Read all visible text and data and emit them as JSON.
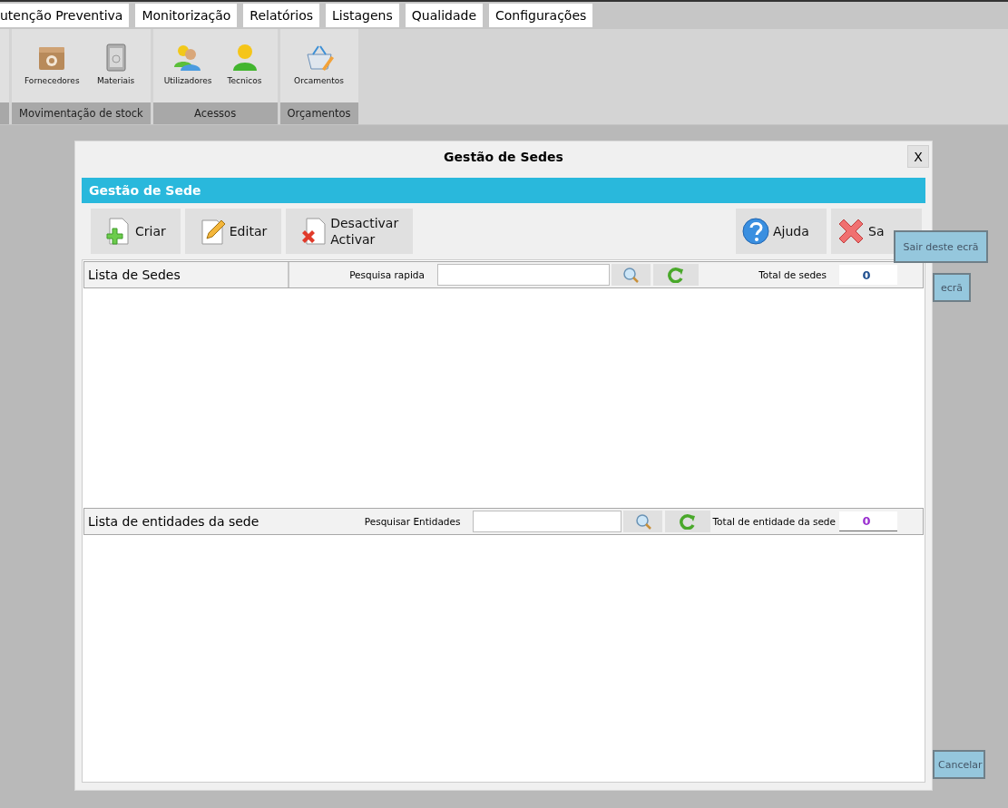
{
  "menu_tabs": [
    {
      "label": "utenção Preventiva"
    },
    {
      "label": "Monitorização"
    },
    {
      "label": "Relatórios"
    },
    {
      "label": "Listagens"
    },
    {
      "label": "Qualidade"
    },
    {
      "label": "Configurações"
    }
  ],
  "ribbon": {
    "groups": [
      {
        "label": "Movimentação de stock",
        "items": [
          {
            "label": "Fornecedores",
            "kind": "box"
          },
          {
            "label": "Materiais",
            "kind": "safe"
          }
        ]
      },
      {
        "label": "Acessos",
        "items": [
          {
            "label": "Utilizadores",
            "kind": "users"
          },
          {
            "label": "Tecnicos",
            "kind": "person"
          }
        ]
      },
      {
        "label": "Orçamentos",
        "items": [
          {
            "label": "Orcamentos",
            "kind": "basket"
          }
        ]
      }
    ]
  },
  "background_buttons": [
    {
      "label": "ecrã"
    },
    {
      "label": "Cancelar"
    }
  ],
  "dialog": {
    "title": "Gestão de Sedes",
    "close": "X",
    "header": "Gestão de Sede",
    "toolbar_left": [
      {
        "lines": [
          "Criar"
        ],
        "kind": "new"
      },
      {
        "lines": [
          "Editar"
        ],
        "kind": "edit"
      },
      {
        "lines": [
          "Desactivar",
          "Activar"
        ],
        "kind": "delete"
      }
    ],
    "toolbar_right": [
      {
        "lines": [
          "Ajuda"
        ],
        "kind": "help"
      },
      {
        "lines": [
          "Sa"
        ],
        "kind": "exit"
      }
    ],
    "tooltip": "Sair deste ecrã",
    "lists": [
      {
        "title": "Lista de Sedes",
        "search_label": "Pesquisa rapida",
        "total_label": "Total de sedes",
        "total": "0",
        "color": "#1f4f8f"
      },
      {
        "title": "Lista de entidades da sede",
        "search_label": "Pesquisar Entidades",
        "total_label": "Total de entidade da sede",
        "total": "0",
        "color": "#9a2fd0"
      }
    ]
  }
}
